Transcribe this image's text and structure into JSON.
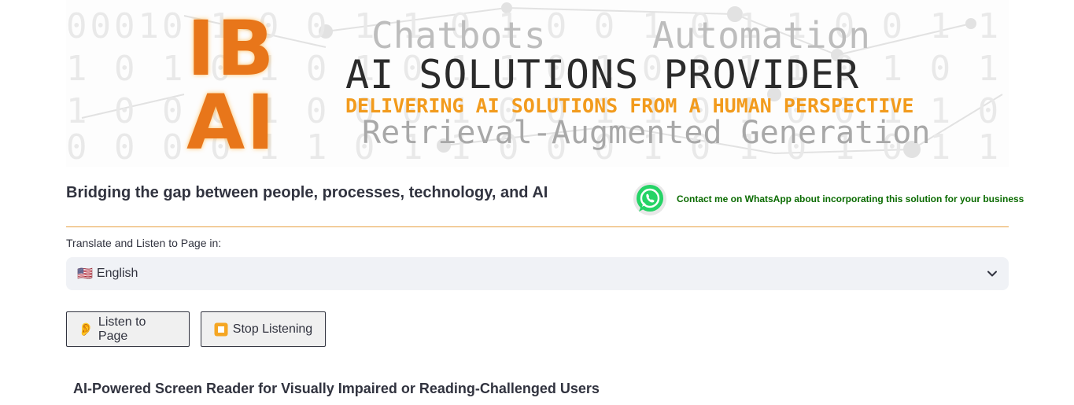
{
  "banner": {
    "logo_line1": "IB",
    "logo_line2": "AI",
    "word_left": "Chatbots",
    "word_right": "Automation",
    "title": "AI SOLUTIONS PROVIDER",
    "subtitle": "DELIVERING AI SOLUTIONS FROM A HUMAN PERSPECTIVE",
    "tagline_bottom": "Retrieval-Augmented Generation",
    "logo_color": "#e8761a",
    "subtitle_color": "#f29b1d"
  },
  "header": {
    "tagline": "Bridging the gap between people, processes, technology, and AI",
    "whatsapp_text": "Contact me on WhatsApp about incorporating this solution for your business",
    "whatsapp_icon": "whatsapp-icon",
    "whatsapp_color": "#25d366",
    "link_color": "#0a6b00",
    "divider_color": "#e8a040"
  },
  "translate": {
    "label": "Translate and Listen to Page in:",
    "flag": "🇺🇸",
    "selected": "English",
    "chevron_icon": "chevron-down-icon"
  },
  "buttons": {
    "listen_icon": "👂",
    "listen_label": "Listen to Page",
    "stop_icon": "stop-icon",
    "stop_label": "Stop Listening"
  },
  "main": {
    "section_title": "AI-Powered Screen Reader for Visually Impaired or Reading-Challenged Users"
  }
}
